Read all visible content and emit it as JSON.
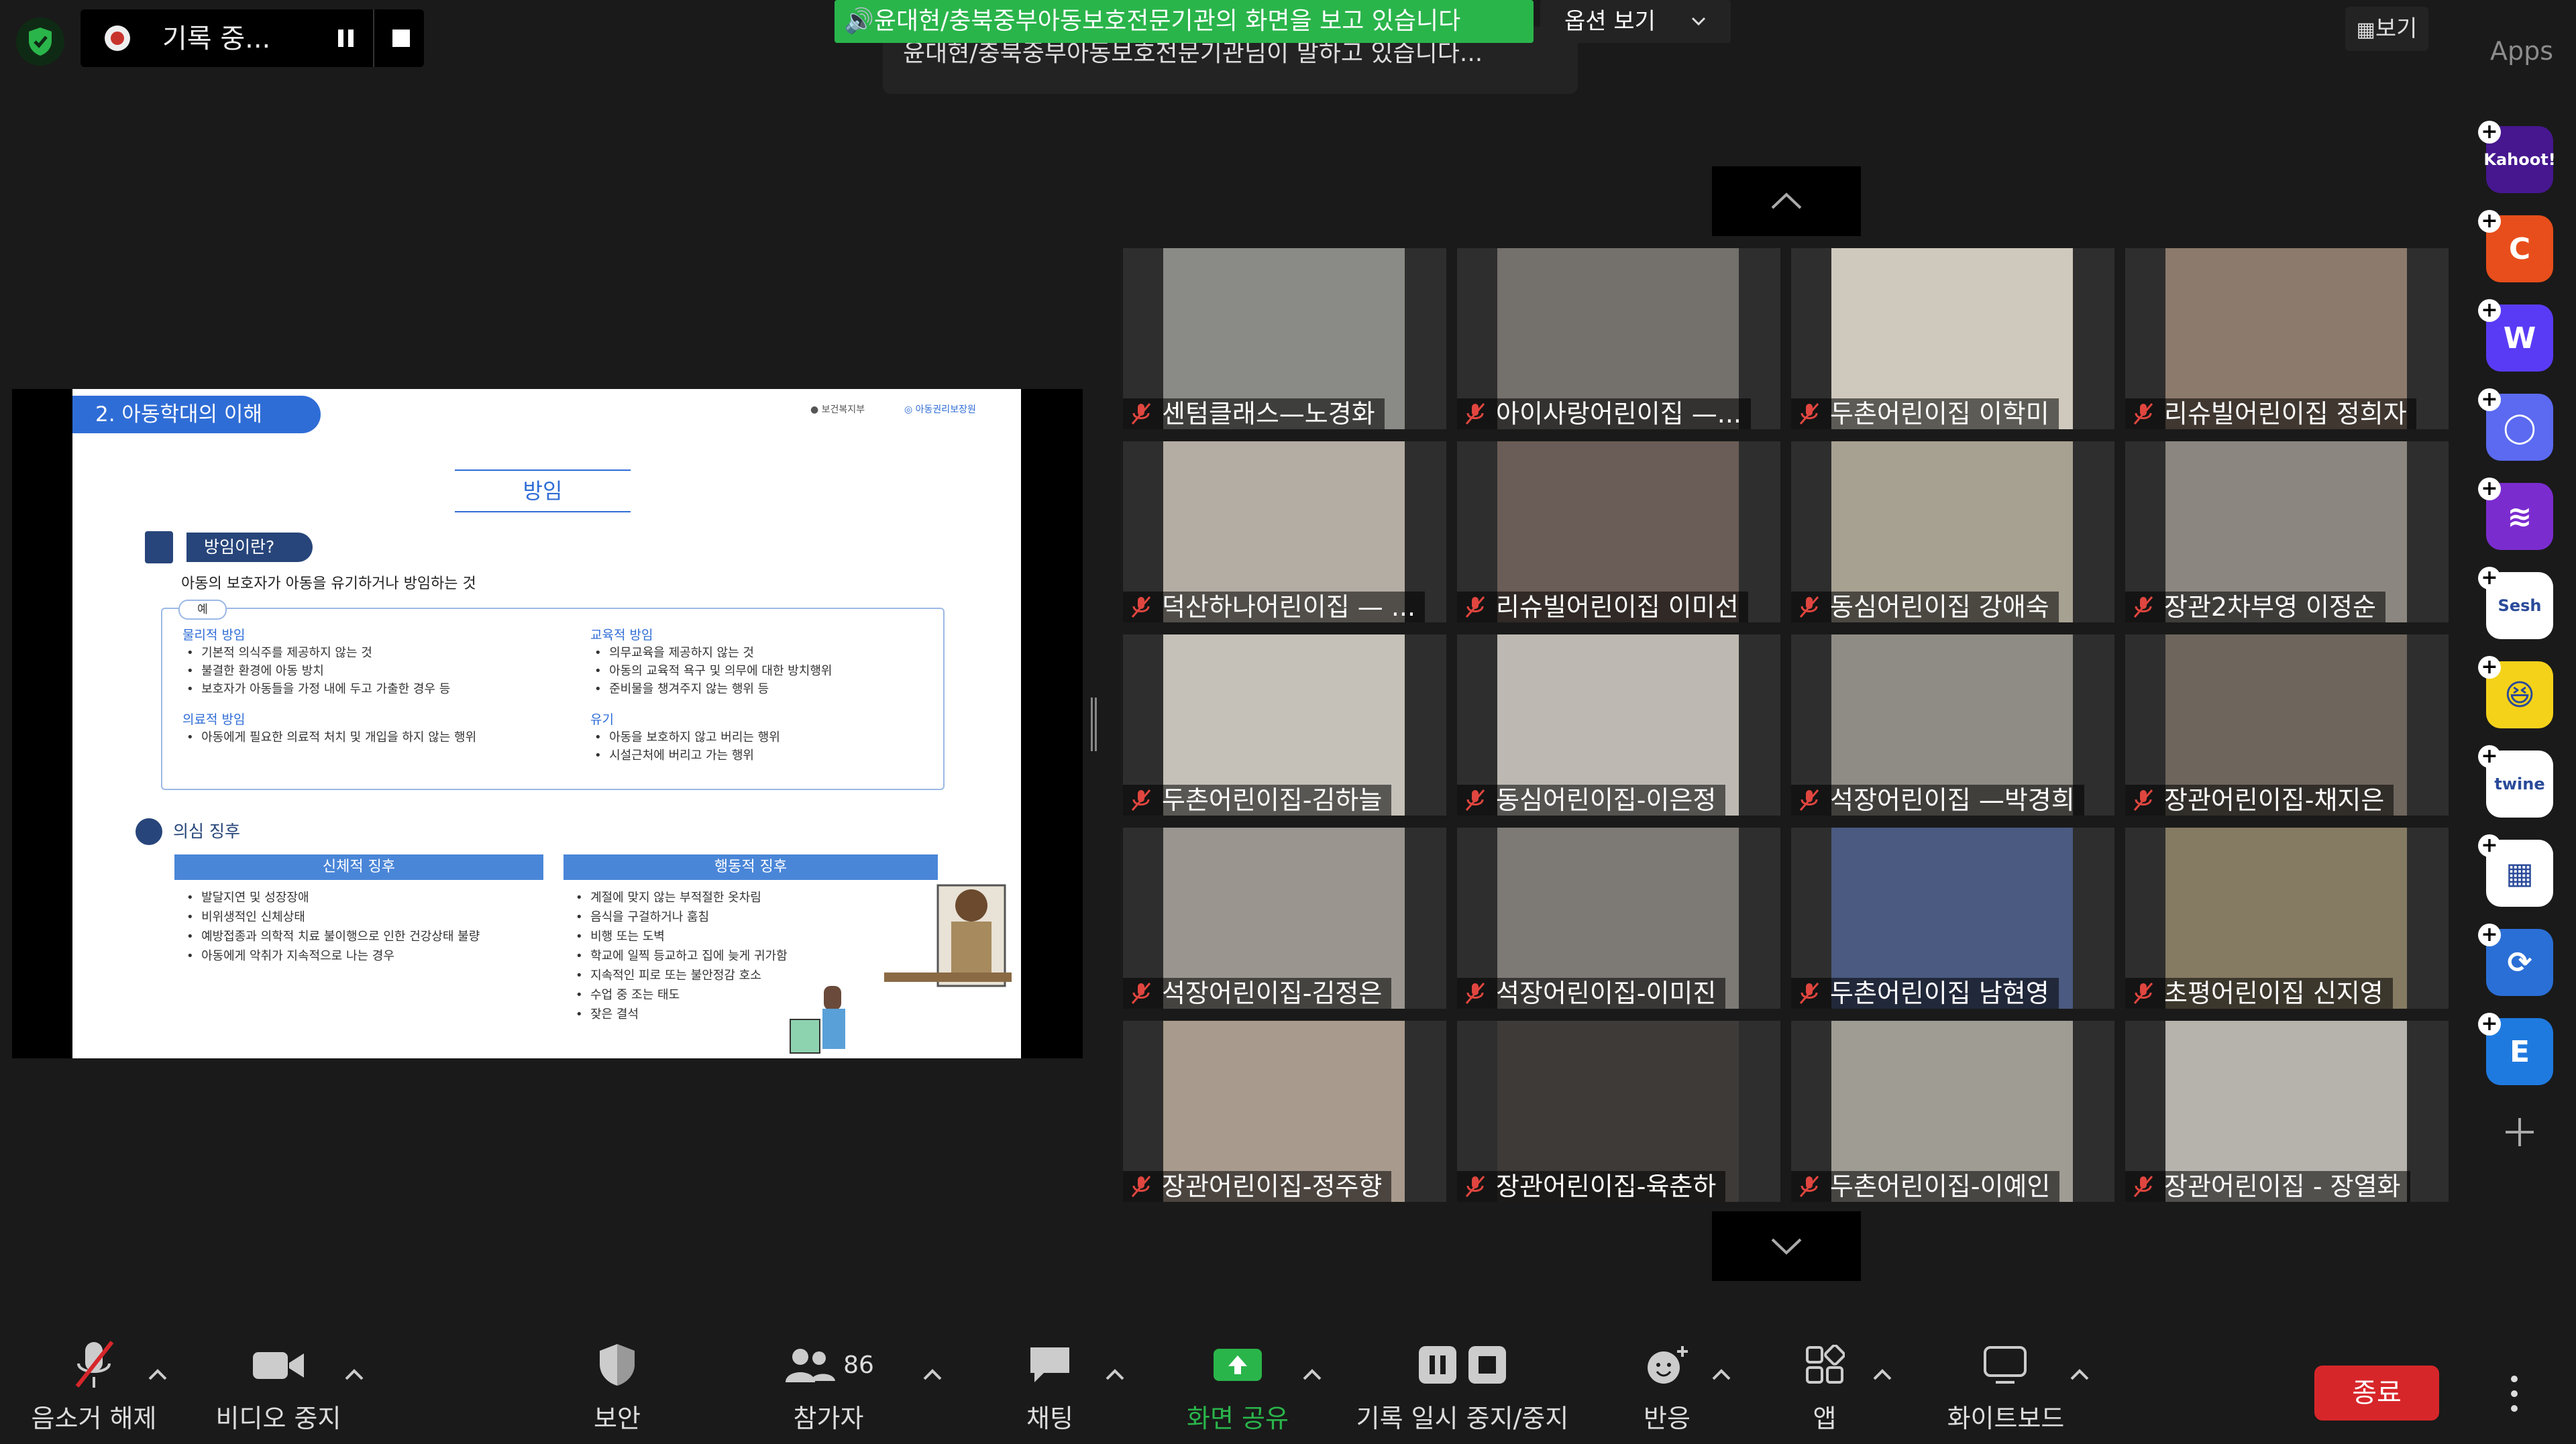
{
  "topbar": {
    "recording_label": "기록 중...",
    "share_banner": "🔊윤대현/충북중부아동보호전문기관의 화면을 보고 있습니다",
    "view_options": "옵션 보기",
    "talking": "윤대현/충북중부아동보호전문기관님이 말하고 있습니다...",
    "view_button": "보기",
    "apps_label": "Apps"
  },
  "slide": {
    "section_title": "2. 아동학대의 이해",
    "logo_1": "보건복지부",
    "logo_2": "아동권리보장원",
    "heading": "방임",
    "what_pill": "방임이란?",
    "definition": "아동의 보호자가 아동을 유기하거나 방임하는 것",
    "example_tag": "예",
    "physical": {
      "title": "물리적 방임",
      "items": [
        "기본적 의식주를 제공하지 않는 것",
        "불결한 환경에 아동 방치",
        "보호자가 아동들을 가정 내에 두고 가출한 경우 등"
      ]
    },
    "medical": {
      "title": "의료적 방임",
      "items": [
        "아동에게 필요한 의료적 처치 및 개입을 하지 않는 행위"
      ]
    },
    "education": {
      "title": "교육적 방임",
      "items": [
        "의무교육을 제공하지 않는 것",
        "아동의 교육적 욕구 및 의무에 대한 방치행위",
        "준비물을 챙겨주지 않는 행위 등"
      ]
    },
    "abandon": {
      "title": "유기",
      "items": [
        "아동을 보호하지 않고 버리는 행위",
        "시설근처에 버리고 가는 행위"
      ]
    },
    "signs_title": "의심 징후",
    "physical_signs": {
      "header": "신체적 징후",
      "items": [
        "발달지연 및 성장장애",
        "비위생적인 신체상태",
        "예방접종과 의학적 치료 불이행으로 인한 건강상태 불량",
        "아동에게 악취가 지속적으로 나는 경우"
      ]
    },
    "behavior_signs": {
      "header": "행동적 징후",
      "items": [
        "계절에 맞지 않는 부적절한 옷차림",
        "음식을 구걸하거나 훔침",
        "비행 또는 도벽",
        "학교에 일찍 등교하고 집에 늦게 귀가함",
        "지속적인 피로 또는 불안정감 호소",
        "수업 중 조는 태도",
        "잦은 결석"
      ]
    }
  },
  "participants": [
    {
      "name": "센텀클래스—노경화",
      "bg": "#8a8a86"
    },
    {
      "name": "아이사랑어린이집 —...",
      "bg": "#74706c"
    },
    {
      "name": "두촌어린이집 이학미",
      "bg": "#cfc9bd"
    },
    {
      "name": "리슈빌어린이집 정희자",
      "bg": "#8c7a6c"
    },
    {
      "name": "덕산하나어린이집 — ...",
      "bg": "#b4ada4"
    },
    {
      "name": "리슈빌어린이집 이미선",
      "bg": "#6a5c56"
    },
    {
      "name": "동심어린이집 강애숙",
      "bg": "#a7a192"
    },
    {
      "name": "장관2차부영 이정순",
      "bg": "#8b8780"
    },
    {
      "name": "두촌어린이집-김하늘",
      "bg": "#c5c0b8"
    },
    {
      "name": "동심어린이집-이은정",
      "bg": "#bdb9b2"
    },
    {
      "name": "석장어린이집 —박경희",
      "bg": "#8f8c85"
    },
    {
      "name": "장관어린이집-채지은",
      "bg": "#6e655c"
    },
    {
      "name": "석장어린이집-김정은",
      "bg": "#9a958f"
    },
    {
      "name": "석장어린이집-이미진",
      "bg": "#7d7a75"
    },
    {
      "name": "두촌어린이집 남현영",
      "bg": "#4a5a80"
    },
    {
      "name": "초평어린이집 신지영",
      "bg": "#857a62"
    },
    {
      "name": "장관어린이집-정주향",
      "bg": "#a89a8c"
    },
    {
      "name": "장관어린이집-육춘하",
      "bg": "#3e3a38"
    },
    {
      "name": "두촌어린이집-이예인",
      "bg": "#9f9c94"
    },
    {
      "name": "장관어린이집 - 장열화",
      "bg": "#b6b2ac"
    }
  ],
  "apps": [
    {
      "name": "Kahoot!",
      "color": "#46178f"
    },
    {
      "name": "C",
      "color": "#e84e1b"
    },
    {
      "name": "W",
      "color": "#5a3bf5"
    },
    {
      "name": "◯",
      "color": "#5b6af0"
    },
    {
      "name": "≋",
      "color": "#7b2ccf"
    },
    {
      "name": "Sesh",
      "color": "#ffffff"
    },
    {
      "name": "😆",
      "color": "#f5d21a"
    },
    {
      "name": "twine",
      "color": "#ffffff"
    },
    {
      "name": "▦",
      "color": "#ffffff"
    },
    {
      "name": "⟳",
      "color": "#2a6fd6"
    },
    {
      "name": "E",
      "color": "#1f7ae0"
    }
  ],
  "toolbar": {
    "mute": "음소거 해제",
    "video": "비디오 중지",
    "security": "보안",
    "participants": "참가자",
    "participants_count": "86",
    "chat": "채팅",
    "share": "화면 공유",
    "record": "기록 일시 중지/중지",
    "reactions": "반응",
    "apps": "앱",
    "whiteboard": "화이트보드",
    "end": "종료"
  },
  "colors": {
    "share_green": "#2ab54b",
    "end_red": "#d7262a",
    "slide_blue": "#2f6dd6"
  }
}
